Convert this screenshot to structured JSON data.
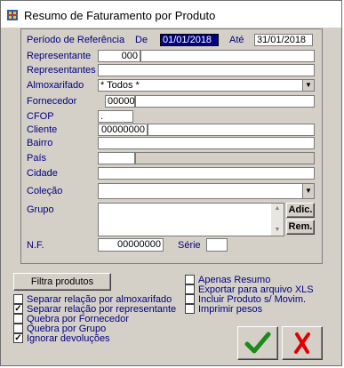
{
  "window": {
    "title": "Resumo de Faturamento por Produto"
  },
  "filters": {
    "periodo_label": "Período de Referência",
    "de_label": "De",
    "de_value": "01/01/2018",
    "ate_label": "Até",
    "ate_value": "31/01/2018",
    "representante_label": "Representante",
    "representante_code": "000",
    "representante_name": "",
    "representantes_label": "Representantes",
    "representantes_value": "",
    "almoxarifado_label": "Almoxarifado",
    "almoxarifado_value": "* Todos *",
    "fornecedor_label": "Fornecedor",
    "fornecedor_code": "00000",
    "fornecedor_name": "",
    "cfop_label": "CFOP",
    "cfop_value": ".",
    "cliente_label": "Cliente",
    "cliente_code": "00000000",
    "cliente_name": "",
    "bairro_label": "Bairro",
    "bairro_value": "",
    "pais_label": "País",
    "pais_code": "",
    "pais_name": "",
    "cidade_label": "Cidade",
    "cidade_value": "",
    "colecao_label": "Coleção",
    "colecao_value": "",
    "grupo_label": "Grupo",
    "adic_label": "Adic.",
    "rem_label": "Rem.",
    "nf_label": "N.F.",
    "nf_value": "00000000",
    "serie_label": "Série",
    "serie_value": ""
  },
  "options": {
    "filtra_label": "Filtra produtos",
    "left": [
      {
        "label": "Separar relação por almoxarifado",
        "checked": false
      },
      {
        "label": "Separar relação por representante",
        "checked": true
      },
      {
        "label": "Quebra por Fornecedor",
        "checked": false
      },
      {
        "label": "Quebra por Grupo",
        "checked": false
      },
      {
        "label": "Ignorar devoluções",
        "checked": true
      }
    ],
    "right": [
      {
        "label": "Apenas Resumo",
        "checked": false
      },
      {
        "label": "Exportar para arquivo XLS",
        "checked": false
      },
      {
        "label": "Incluir Produto s/ Movim.",
        "checked": false
      },
      {
        "label": "Imprimir pesos",
        "checked": false
      }
    ]
  },
  "actions": {
    "ok_icon": "checkmark-icon",
    "ok_color": "#1a8a1a",
    "cancel_icon": "x-icon",
    "cancel_color": "#e00000"
  }
}
